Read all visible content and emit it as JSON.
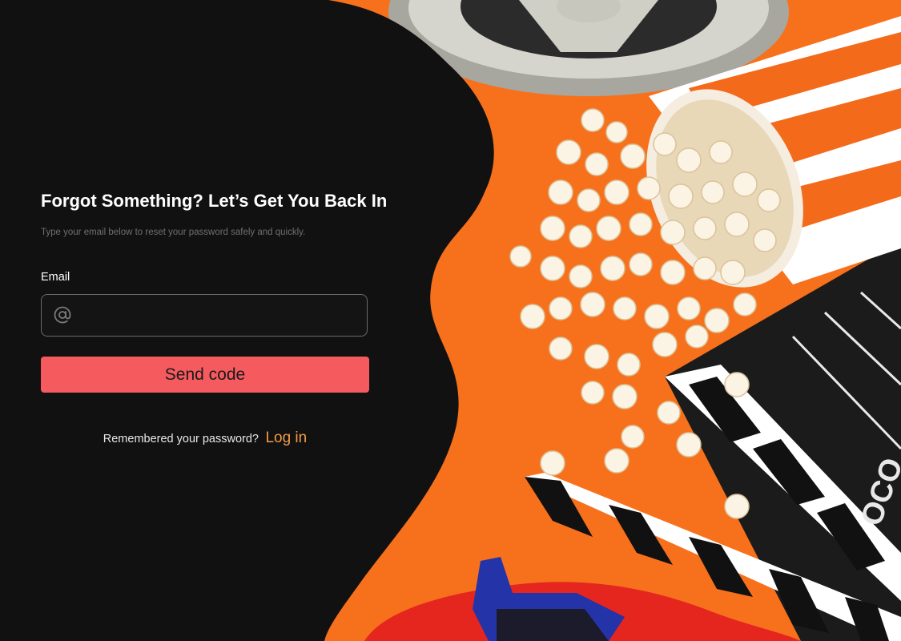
{
  "hero": {
    "image_name": "cinema-popcorn-illustration",
    "clapper_text": "OCO"
  },
  "form": {
    "title": "Forgot Something? Let’s Get You Back In",
    "subtitle": "Type your email below to reset your password safely and quickly.",
    "email_label": "Email",
    "email_icon": "at-icon",
    "email_value": "",
    "send_button_label": "Send code"
  },
  "footer": {
    "prompt": "Remembered your password?",
    "login_link": "Log in"
  },
  "colors": {
    "background": "#111111",
    "accent_button": "#f55a5f",
    "link": "#f39a45",
    "orange_backdrop": "#f7711c"
  }
}
